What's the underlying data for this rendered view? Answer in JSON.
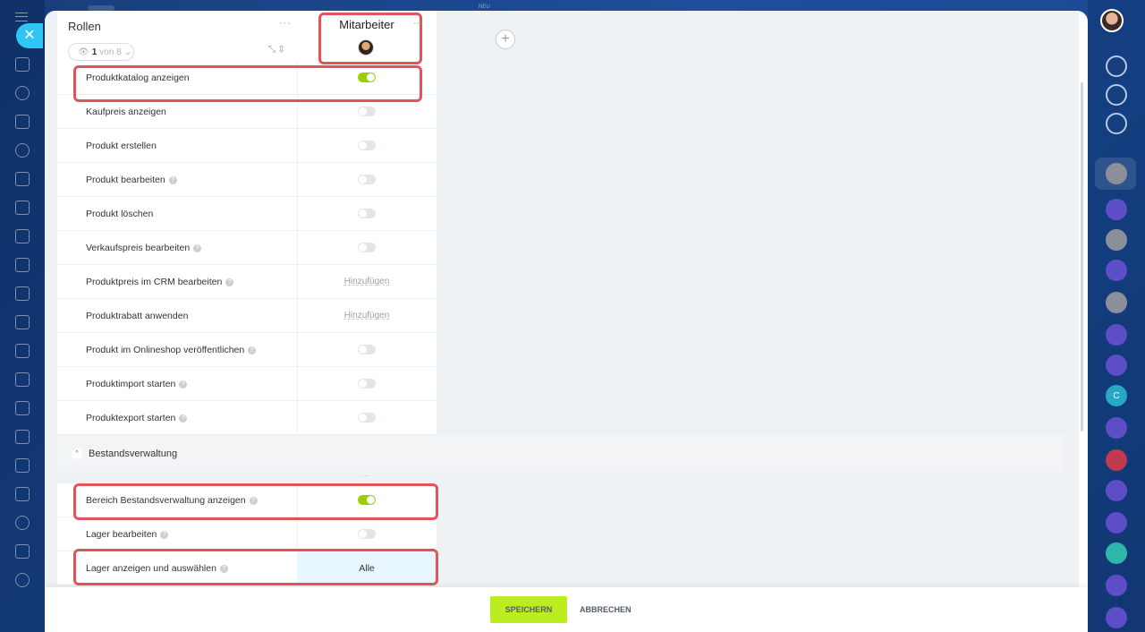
{
  "topbar": {
    "new_label": "NEU"
  },
  "roles": {
    "title": "Rollen",
    "pager_current": "1",
    "pager_total": "von 8"
  },
  "column": {
    "title": "Mitarbeiter",
    "add_symbol": "+"
  },
  "rows": [
    {
      "label": "Produktkatalog anzeigen",
      "help": false,
      "type": "toggle",
      "on": true
    },
    {
      "label": "Kaufpreis anzeigen",
      "help": false,
      "type": "toggle",
      "on": false
    },
    {
      "label": "Produkt erstellen",
      "help": false,
      "type": "toggle",
      "on": false
    },
    {
      "label": "Produkt bearbeiten",
      "help": true,
      "type": "toggle",
      "on": false
    },
    {
      "label": "Produkt löschen",
      "help": false,
      "type": "toggle",
      "on": false
    },
    {
      "label": "Verkaufspreis bearbeiten",
      "help": true,
      "type": "toggle",
      "on": false
    },
    {
      "label": "Produktpreis im CRM bearbeiten",
      "help": true,
      "type": "link",
      "value": "Hinzufügen"
    },
    {
      "label": "Produktrabatt anwenden",
      "help": false,
      "type": "link",
      "value": "Hinzufügen"
    },
    {
      "label": "Produkt im Onlineshop veröffentlichen",
      "help": true,
      "type": "toggle",
      "on": false
    },
    {
      "label": "Produktimport starten",
      "help": true,
      "type": "toggle",
      "on": false
    },
    {
      "label": "Produktexport starten",
      "help": true,
      "type": "toggle",
      "on": false
    }
  ],
  "section": {
    "title": "Bestandsverwaltung"
  },
  "section_rows": [
    {
      "label": "Bereich Bestandsverwaltung anzeigen",
      "help": true,
      "type": "toggle",
      "on": true
    },
    {
      "label": "Lager bearbeiten",
      "help": true,
      "type": "toggle",
      "on": false
    },
    {
      "label": "Lager anzeigen und auswählen",
      "help": true,
      "type": "value",
      "value": "Alle"
    }
  ],
  "footer": {
    "save_label": "SPEICHERN",
    "cancel_label": "ABBRECHEN"
  },
  "right_sidebar": {
    "contact_letter": "C"
  },
  "colors": {
    "toggle_on": "#9dcf00",
    "highlight": "#e0555a",
    "save": "#bbed21",
    "accent": "#2fc6f6"
  }
}
